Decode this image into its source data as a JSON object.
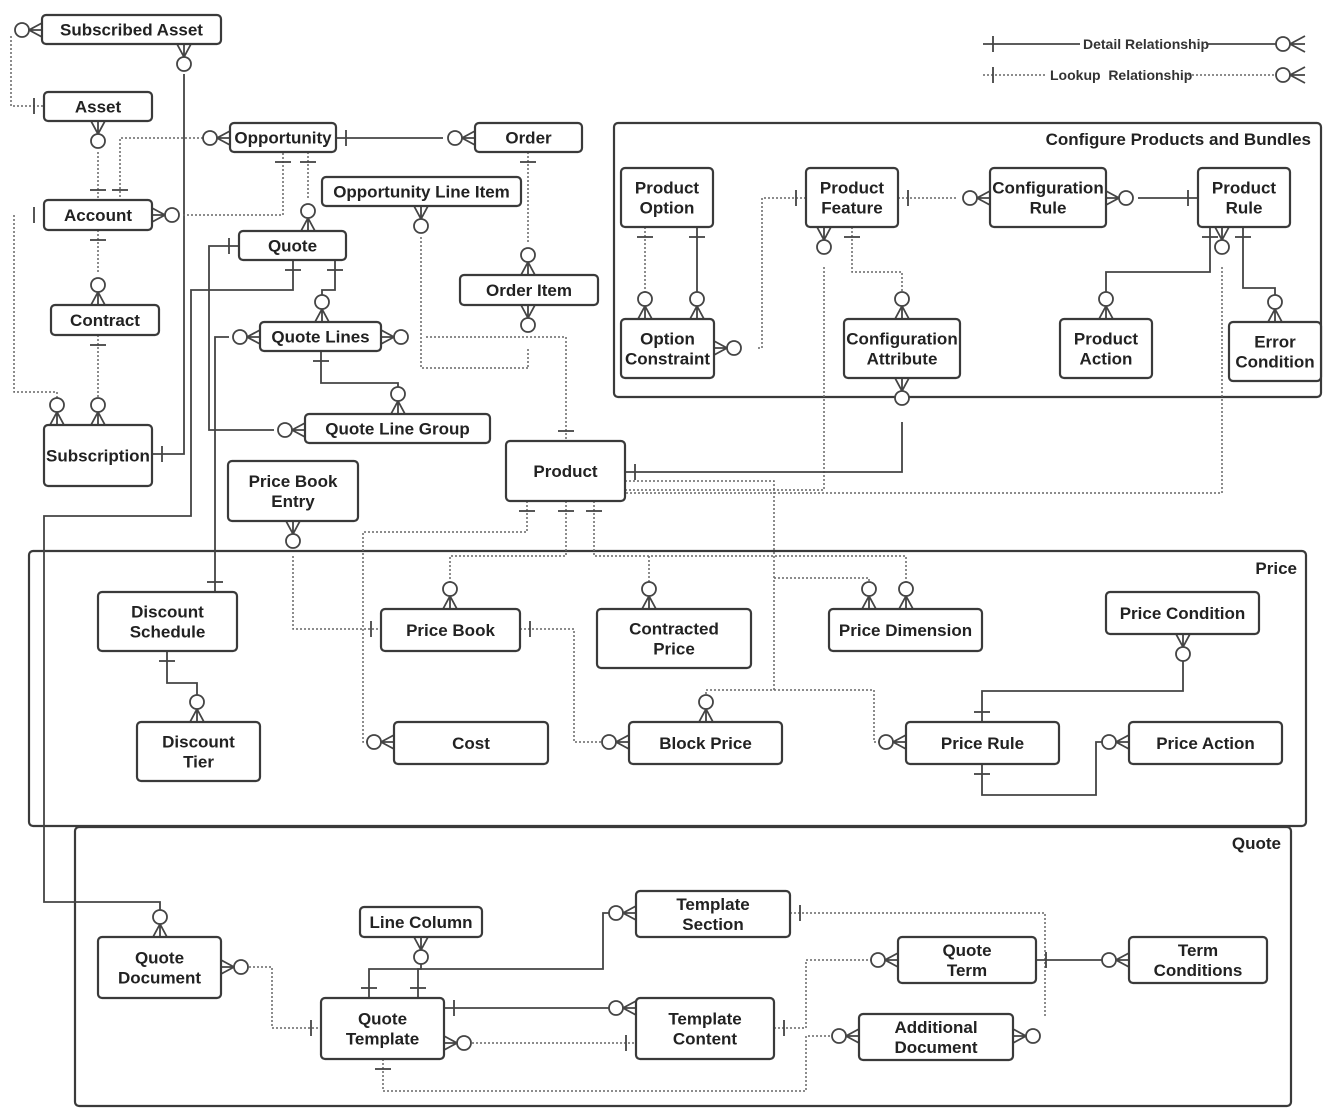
{
  "legend": {
    "detail": "Detail Relationship",
    "lookup": "Lookup  Relationship"
  },
  "groups": {
    "configure": "Configure Products and Bundles",
    "price": "Price",
    "quote": "Quote"
  },
  "entities": {
    "subscribed_asset": [
      "Subscribed Asset"
    ],
    "asset": [
      "Asset"
    ],
    "opportunity": [
      "Opportunity"
    ],
    "order": [
      "Order"
    ],
    "account": [
      "Account"
    ],
    "opportunity_line_item": [
      "Opportunity Line Item"
    ],
    "quote": [
      "Quote"
    ],
    "order_item": [
      "Order Item"
    ],
    "contract": [
      "Contract"
    ],
    "quote_lines": [
      "Quote Lines"
    ],
    "subscription": [
      "Subscription"
    ],
    "quote_line_group": [
      "Quote Line Group"
    ],
    "price_book_entry": [
      "Price Book",
      "Entry"
    ],
    "product": [
      "Product"
    ],
    "product_option": [
      "Product",
      "Option"
    ],
    "product_feature": [
      "Product",
      "Feature"
    ],
    "configuration_rule": [
      "Configuration",
      "Rule"
    ],
    "product_rule": [
      "Product",
      "Rule"
    ],
    "option_constraint": [
      "Option",
      "Constraint"
    ],
    "configuration_attribute": [
      "Configuration",
      "Attribute"
    ],
    "product_action": [
      "Product",
      "Action"
    ],
    "error_condition": [
      "Error",
      "Condition"
    ],
    "discount_schedule": [
      "Discount",
      "Schedule"
    ],
    "price_book": [
      "Price Book"
    ],
    "contracted_price": [
      "Contracted",
      "Price"
    ],
    "price_dimension": [
      "Price Dimension"
    ],
    "price_condition": [
      "Price Condition"
    ],
    "discount_tier": [
      "Discount",
      "Tier"
    ],
    "cost": [
      "Cost"
    ],
    "block_price": [
      "Block Price"
    ],
    "price_rule": [
      "Price Rule"
    ],
    "price_action": [
      "Price Action"
    ],
    "quote_document": [
      "Quote",
      "Document"
    ],
    "line_column": [
      "Line Column"
    ],
    "template_section": [
      "Template",
      "Section"
    ],
    "quote_term": [
      "Quote",
      "Term"
    ],
    "term_conditions": [
      "Term",
      "Conditions"
    ],
    "quote_template": [
      "Quote",
      "Template"
    ],
    "template_content": [
      "Template",
      "Content"
    ],
    "additional_document": [
      "Additional",
      "Document"
    ]
  }
}
